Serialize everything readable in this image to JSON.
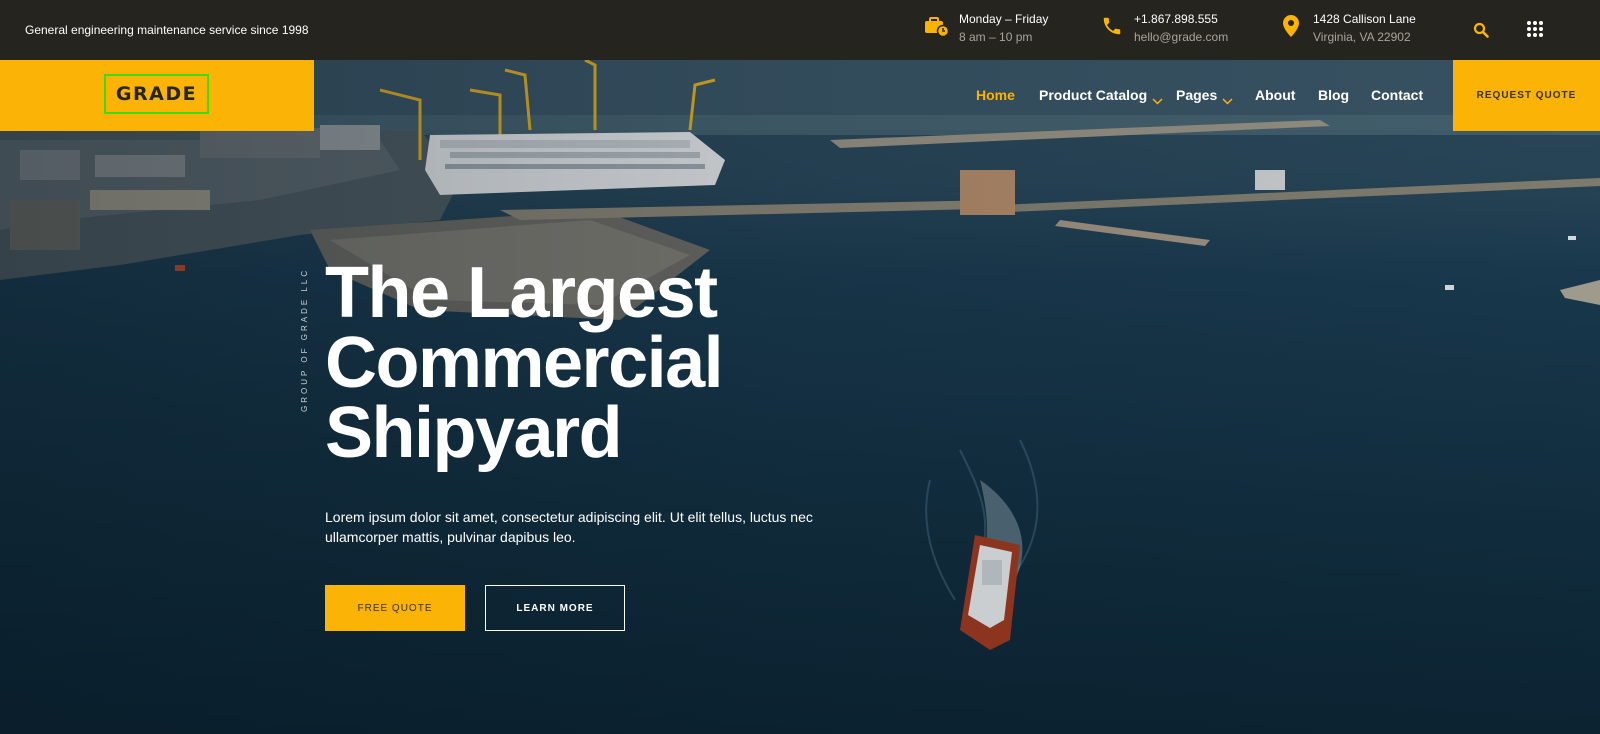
{
  "topbar": {
    "tagline": "General engineering maintenance service since 1998",
    "hours": {
      "title": "Monday – Friday",
      "sub": "8 am – 10 pm",
      "icon": "briefcase-clock-icon"
    },
    "phone": {
      "title": "+1.867.898.555",
      "sub": "hello@grade.com",
      "icon": "phone-icon"
    },
    "address": {
      "title": "1428 Callison Lane",
      "sub": "Virginia, VA 22902",
      "icon": "location-pin-icon"
    },
    "accent": "#fbb305",
    "background": "#25241e"
  },
  "brand": {
    "logo_text": "GRADE",
    "accent": "#fbb305"
  },
  "nav": {
    "items": [
      {
        "label": "Home",
        "active": true
      },
      {
        "label": "Product Catalog",
        "has_dropdown": true
      },
      {
        "label": "Pages",
        "has_dropdown": true
      },
      {
        "label": "About"
      },
      {
        "label": "Blog"
      },
      {
        "label": "Contact"
      }
    ],
    "cta": "REQUEST QUOTE"
  },
  "hero": {
    "vertical_label": "GROUP OF GRADE LLC",
    "headline": [
      "The Largest",
      "Commercial",
      "Shipyard"
    ],
    "lead": "Lorem ipsum dolor sit amet, consectetur adipiscing elit. Ut elit tellus, luctus nec ullamcorper mattis, pulvinar dapibus leo.",
    "primary_button": "FREE QUOTE",
    "secondary_button": "LEARN MORE"
  }
}
